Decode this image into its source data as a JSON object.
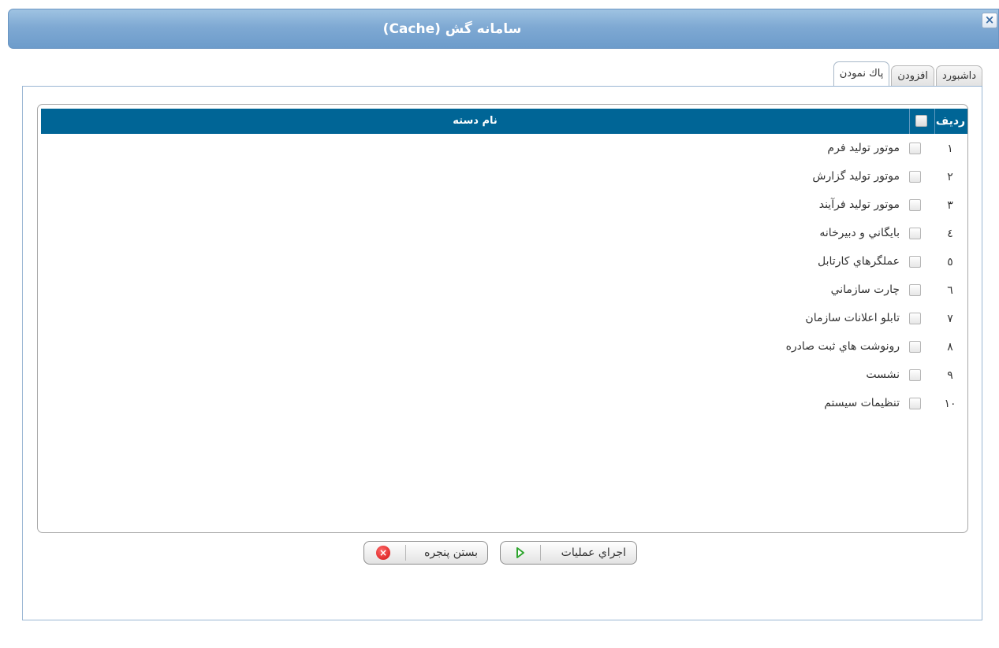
{
  "window": {
    "title": "سامانه گش (Cache)",
    "close_glyph": "×"
  },
  "tabs": [
    {
      "label": "پاك نمودن",
      "active": true
    },
    {
      "label": "افزودن",
      "active": false
    },
    {
      "label": "داشبورد",
      "active": false
    }
  ],
  "grid": {
    "columns": {
      "row": "رديف",
      "name": "نام دسته"
    },
    "rows": [
      {
        "num": "١",
        "label": "موتور توليد فرم"
      },
      {
        "num": "٢",
        "label": "موتور توليد گزارش"
      },
      {
        "num": "٣",
        "label": "موتور توليد فرآيند"
      },
      {
        "num": "٤",
        "label": "بايگاني و دبيرخانه"
      },
      {
        "num": "٥",
        "label": "عملگرهاي كارتابل"
      },
      {
        "num": "٦",
        "label": "چارت سازماني"
      },
      {
        "num": "٧",
        "label": "تابلو اعلانات سازمان"
      },
      {
        "num": "٨",
        "label": "رونوشت هاي ثبت صادره"
      },
      {
        "num": "٩",
        "label": "نشست"
      },
      {
        "num": "١٠",
        "label": "تنظيمات سيستم"
      }
    ]
  },
  "buttons": {
    "run": "اجراي عمليات",
    "close": "بستن پنجره"
  },
  "colors": {
    "header": "#006596",
    "titlebar": "#7fa9d3",
    "run_icon": "#2fa52f",
    "close_icon": "#d21010"
  }
}
